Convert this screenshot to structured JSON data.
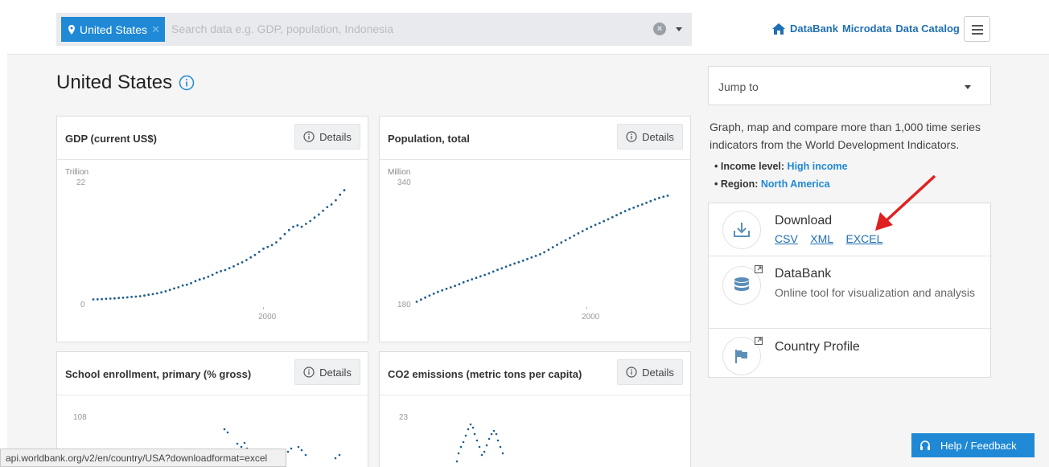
{
  "search": {
    "chip_label": "United States",
    "placeholder": "Search data e.g. GDP, population, Indonesia"
  },
  "nav": {
    "links": [
      "DataBank",
      "Microdata",
      "Data Catalog"
    ]
  },
  "country": {
    "title": "United States"
  },
  "cards": [
    {
      "title": "GDP (current US$)",
      "details": "Details",
      "unit": "Trillion",
      "ymax": "22",
      "ymin": "0",
      "xtick": "2000"
    },
    {
      "title": "Population, total",
      "details": "Details",
      "unit": "Million",
      "ymax": "340",
      "ymin": "180",
      "xtick": "2000"
    },
    {
      "title": "School enrollment, primary (% gross)",
      "details": "Details",
      "ymax": "108"
    },
    {
      "title": "CO2 emissions (metric tons per capita)",
      "details": "Details",
      "ymax": "23"
    }
  ],
  "sidebar": {
    "jump_to": "Jump to",
    "description": "Graph, map and compare more than 1,000 time series indicators from the World Development Indicators.",
    "income_label": "Income level:",
    "income_value": "High income",
    "region_label": "Region:",
    "region_value": "North America"
  },
  "actions": {
    "download": {
      "title": "Download",
      "links": [
        "CSV",
        "XML",
        "EXCEL"
      ]
    },
    "databank": {
      "title": "DataBank",
      "subtitle": "Online tool for visualization and analysis"
    },
    "profile": {
      "title": "Country Profile"
    }
  },
  "help_label": "Help / Feedback",
  "status_url": "api.worldbank.org/v2/en/country/USA?downloadformat=excel",
  "colors": {
    "brand": "#1f89d6",
    "link": "#1f6fb3",
    "chart_dots": "#1f5f8f",
    "arrow": "#e0201e"
  },
  "chart_data": [
    {
      "type": "scatter",
      "title": "GDP (current US$)",
      "ylabel": "Trillion",
      "x": [
        1960,
        1961,
        1962,
        1963,
        1964,
        1965,
        1966,
        1967,
        1968,
        1969,
        1970,
        1971,
        1972,
        1973,
        1974,
        1975,
        1976,
        1977,
        1978,
        1979,
        1980,
        1981,
        1982,
        1983,
        1984,
        1985,
        1986,
        1987,
        1988,
        1989,
        1990,
        1991,
        1992,
        1993,
        1994,
        1995,
        1996,
        1997,
        1998,
        1999,
        2000,
        2001,
        2002,
        2003,
        2004,
        2005,
        2006,
        2007,
        2008,
        2009,
        2010,
        2011,
        2012,
        2013,
        2014,
        2015,
        2016,
        2017,
        2018,
        2019
      ],
      "values": [
        0.54,
        0.56,
        0.6,
        0.64,
        0.69,
        0.74,
        0.81,
        0.86,
        0.94,
        1.02,
        1.07,
        1.16,
        1.28,
        1.43,
        1.55,
        1.69,
        1.88,
        2.09,
        2.36,
        2.63,
        2.86,
        3.21,
        3.34,
        3.64,
        4.04,
        4.35,
        4.59,
        4.87,
        5.25,
        5.66,
        5.96,
        6.16,
        6.52,
        6.86,
        7.29,
        7.64,
        8.07,
        8.58,
        9.06,
        9.63,
        10.25,
        10.58,
        10.94,
        11.46,
        12.21,
        13.04,
        13.81,
        14.45,
        14.71,
        14.45,
        15.0,
        15.54,
        16.2,
        16.78,
        17.52,
        18.22,
        18.71,
        19.52,
        20.58,
        21.43
      ],
      "ylim": [
        0,
        22
      ]
    },
    {
      "type": "scatter",
      "title": "Population, total",
      "ylabel": "Million",
      "x": [
        1960,
        1961,
        1962,
        1963,
        1964,
        1965,
        1966,
        1967,
        1968,
        1969,
        1970,
        1971,
        1972,
        1973,
        1974,
        1975,
        1976,
        1977,
        1978,
        1979,
        1980,
        1981,
        1982,
        1983,
        1984,
        1985,
        1986,
        1987,
        1988,
        1989,
        1990,
        1991,
        1992,
        1993,
        1994,
        1995,
        1996,
        1997,
        1998,
        1999,
        2000,
        2001,
        2002,
        2003,
        2004,
        2005,
        2006,
        2007,
        2008,
        2009,
        2010,
        2011,
        2012,
        2013,
        2014,
        2015,
        2016,
        2017,
        2018,
        2019
      ],
      "values": [
        180.7,
        183.7,
        186.5,
        189.2,
        191.9,
        194.3,
        196.6,
        198.7,
        200.7,
        202.7,
        205.1,
        207.7,
        209.9,
        211.9,
        213.9,
        216.0,
        218.0,
        220.2,
        222.6,
        225.1,
        227.2,
        229.5,
        231.7,
        233.8,
        235.8,
        237.9,
        240.1,
        242.3,
        244.5,
        246.8,
        249.6,
        253.0,
        256.5,
        259.9,
        263.1,
        266.3,
        269.4,
        272.7,
        275.9,
        279.0,
        282.2,
        285.0,
        287.6,
        290.1,
        292.8,
        295.5,
        298.4,
        301.2,
        304.1,
        306.8,
        309.3,
        311.6,
        313.9,
        316.1,
        318.4,
        320.7,
        323.1,
        325.1,
        326.8,
        328.2
      ],
      "ylim": [
        180,
        340
      ]
    }
  ]
}
